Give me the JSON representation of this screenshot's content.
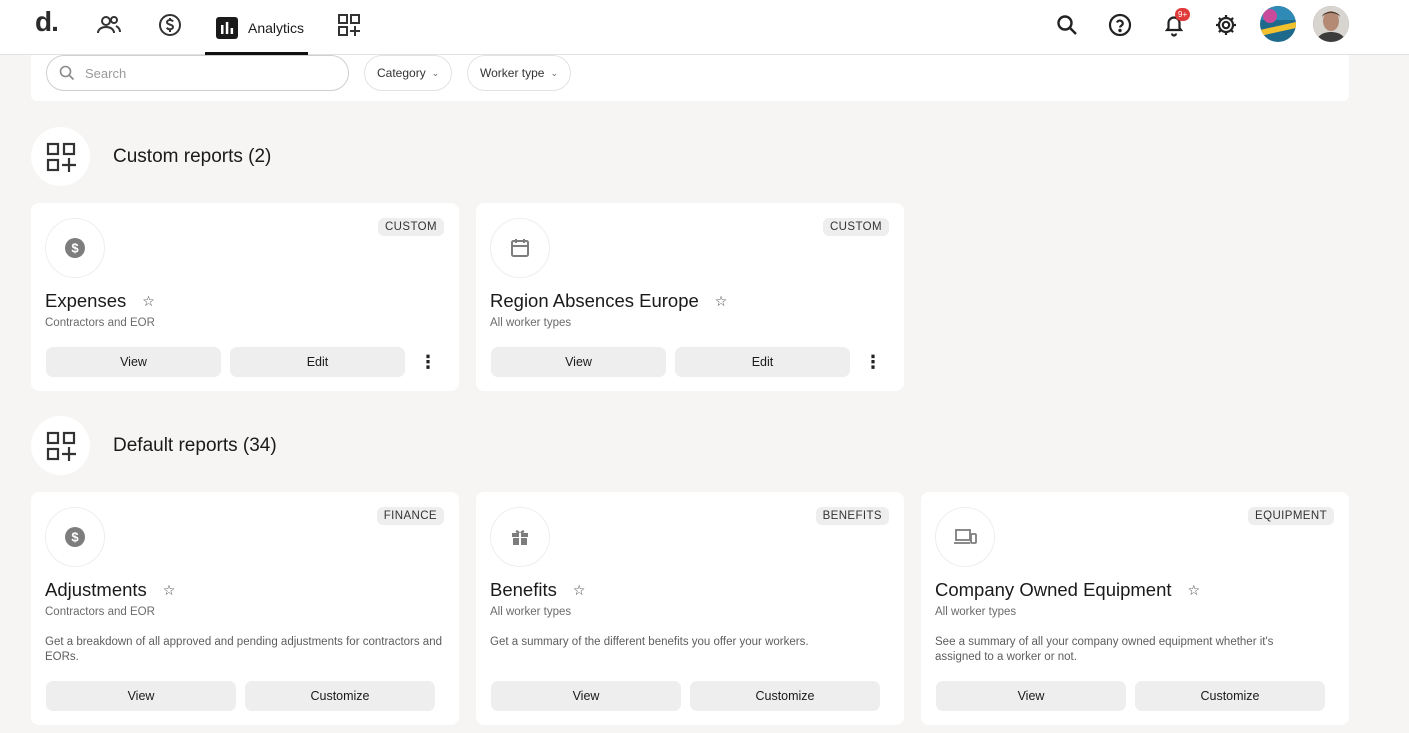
{
  "nav": {
    "logo": "d.",
    "analytics_label": "Analytics",
    "notification_badge": "9+"
  },
  "filters": {
    "search_placeholder": "Search",
    "category_label": "Category",
    "worker_type_label": "Worker type"
  },
  "custom_section": {
    "title": "Custom reports (2)",
    "cards": [
      {
        "icon": "dollar-icon",
        "tag": "CUSTOM",
        "title": "Expenses",
        "subtitle": "Contractors and EOR",
        "view_label": "View",
        "edit_label": "Edit"
      },
      {
        "icon": "calendar-icon",
        "tag": "CUSTOM",
        "title": "Region Absences Europe",
        "subtitle": "All worker types",
        "view_label": "View",
        "edit_label": "Edit"
      }
    ]
  },
  "default_section": {
    "title": "Default reports (34)",
    "cards": [
      {
        "icon": "dollar-icon",
        "tag": "FINANCE",
        "title": "Adjustments",
        "subtitle": "Contractors and EOR",
        "description": "Get a breakdown of all approved and pending adjustments for contractors and EORs.",
        "view_label": "View",
        "customize_label": "Customize"
      },
      {
        "icon": "gift-icon",
        "tag": "BENEFITS",
        "title": "Benefits",
        "subtitle": "All worker types",
        "description": "Get a summary of the different benefits you offer your workers.",
        "view_label": "View",
        "customize_label": "Customize"
      },
      {
        "icon": "devices-icon",
        "tag": "EQUIPMENT",
        "title": "Company Owned Equipment",
        "subtitle": "All worker types",
        "description": "See a summary of all your company owned equipment whether it's assigned to a worker or not.",
        "view_label": "View",
        "customize_label": "Customize"
      }
    ]
  },
  "colors": {
    "background": "#f6f5f3",
    "card": "#ffffff",
    "button": "#eeeeee",
    "badge": "#e03a3a"
  }
}
